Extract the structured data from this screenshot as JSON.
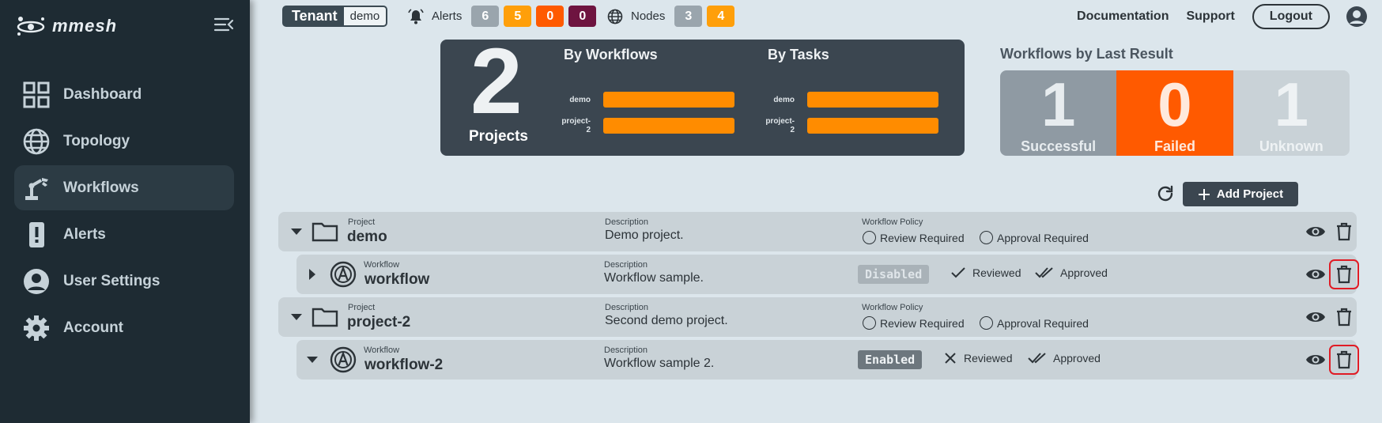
{
  "app": {
    "logo_text": "mmesh"
  },
  "sidebar": {
    "items": [
      {
        "label": "Dashboard",
        "icon": "grid-icon"
      },
      {
        "label": "Topology",
        "icon": "globe-icon"
      },
      {
        "label": "Workflows",
        "icon": "robot-arm-icon",
        "active": true
      },
      {
        "label": "Alerts",
        "icon": "alert-phone-icon"
      },
      {
        "label": "User Settings",
        "icon": "user-circle-icon"
      },
      {
        "label": "Account",
        "icon": "gear-icon"
      }
    ]
  },
  "topbar": {
    "tenant_label": "Tenant",
    "tenant_value": "demo",
    "alerts_label": "Alerts",
    "alert_badges": [
      {
        "value": "6",
        "color": "#9aa5ad"
      },
      {
        "value": "5",
        "color": "#ff9f0a"
      },
      {
        "value": "0",
        "color": "#ff5a00"
      },
      {
        "value": "0",
        "color": "#6e1440"
      }
    ],
    "nodes_label": "Nodes",
    "node_badges": [
      {
        "value": "3",
        "color": "#9aa5ad"
      },
      {
        "value": "4",
        "color": "#ff9f0a"
      }
    ],
    "documentation": "Documentation",
    "support": "Support",
    "logout": "Logout"
  },
  "summary": {
    "count": "2",
    "count_label": "Projects",
    "by_workflows_title": "By Workflows",
    "by_tasks_title": "By Tasks",
    "by_workflows": [
      {
        "name": "demo",
        "value": 1
      },
      {
        "name": "project-2",
        "value": 1
      }
    ],
    "by_tasks": [
      {
        "name": "demo",
        "value": 1
      },
      {
        "name": "project-2",
        "value": 1
      }
    ]
  },
  "last_result": {
    "title": "Workflows by Last Result",
    "cells": [
      {
        "value": "1",
        "label": "Successful",
        "bg": "#8f9aa3",
        "fg": "#e7ecef"
      },
      {
        "value": "0",
        "label": "Failed",
        "bg": "#ff5a00",
        "fg": "#ffe9dc"
      },
      {
        "value": "1",
        "label": "Unknown",
        "bg": "#c9d2d7",
        "fg": "#eef2f4"
      }
    ]
  },
  "actions": {
    "add_project": "Add Project"
  },
  "labels": {
    "project": "Project",
    "workflow": "Workflow",
    "description": "Description",
    "workflow_policy": "Workflow Policy",
    "review_required": "Review Required",
    "approval_required": "Approval Required",
    "reviewed": "Reviewed",
    "approved": "Approved"
  },
  "rows": [
    {
      "type": "project",
      "name": "demo",
      "description": "Demo project."
    },
    {
      "type": "workflow",
      "name": "workflow",
      "description": "Workflow sample.",
      "status": "Disabled",
      "reviewed": true,
      "expanded": false
    },
    {
      "type": "project",
      "name": "project-2",
      "description": "Second demo project."
    },
    {
      "type": "workflow",
      "name": "workflow-2",
      "description": "Workflow sample 2.",
      "status": "Enabled",
      "reviewed": false,
      "expanded": true
    }
  ]
}
